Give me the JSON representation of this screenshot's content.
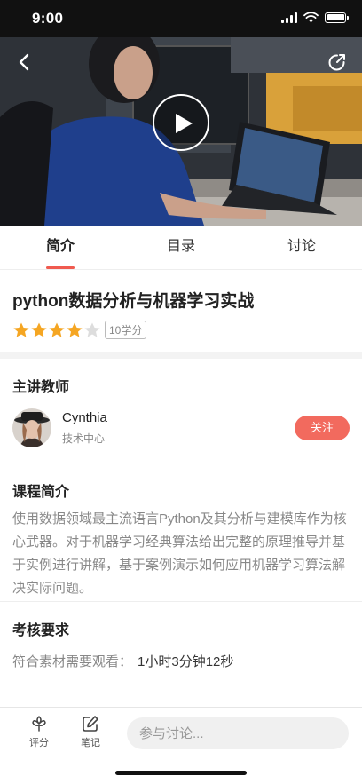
{
  "status_bar": {
    "time": "9:00"
  },
  "video": {
    "play_icon": "play-icon",
    "back_icon": "back-arrow-icon",
    "share_icon": "share-icon"
  },
  "tabs": [
    {
      "label": "简介",
      "active": true
    },
    {
      "label": "目录",
      "active": false
    },
    {
      "label": "讨论",
      "active": false
    }
  ],
  "course": {
    "title": "python数据分析与机器学习实战",
    "rating": 4,
    "rating_max": 5,
    "credits": "10学分"
  },
  "teacher": {
    "section_title": "主讲教师",
    "name": "Cynthia",
    "department": "技术中心",
    "follow_label": "关注"
  },
  "intro": {
    "section_title": "课程简介",
    "text": "使用数据领域最主流语言Python及其分析与建模库作为核心武器。对于机器学习经典算法给出完整的原理推导并基于实例进行讲解，基于案例演示如何应用机器学习算法解决实际问题。"
  },
  "exam": {
    "section_title": "考核要求",
    "label": "符合素材需要观看：",
    "value": "1小时3分钟12秒"
  },
  "bottom_bar": {
    "rate_label": "评分",
    "notes_label": "笔记",
    "comment_placeholder": "参与讨论..."
  },
  "colors": {
    "accent": "#f05a4f",
    "star": "#f5a623",
    "star_empty": "#dddddd"
  }
}
